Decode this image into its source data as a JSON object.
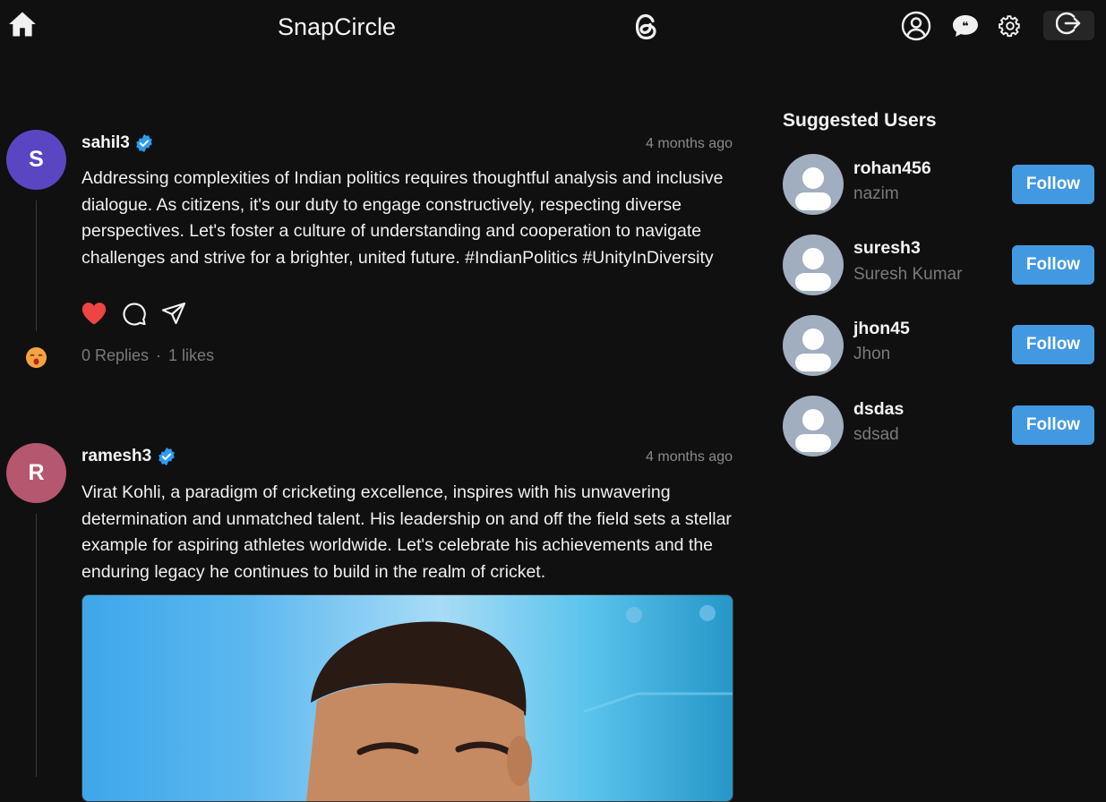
{
  "header": {
    "title": "SnapCircle",
    "icons": [
      "home-icon",
      "threads-logo-icon",
      "profile-icon",
      "chat-icon",
      "gear-icon",
      "logout-icon"
    ]
  },
  "posts": [
    {
      "avatar_letter": "S",
      "avatar_color": "#5a46c2",
      "username": "sahil3",
      "time": "4 months ago",
      "text": "Addressing complexities of Indian politics requires thoughtful analysis and inclusive dialogue. As citizens, it's our duty to engage constructively, respecting diverse perspectives. Let's foster a culture of understanding and cooperation to navigate challenges and strive for a brighter, united future. #IndianPolitics #UnityInDiversity",
      "replies": "0 Replies",
      "separator": "·",
      "likes": "1 likes",
      "liked": true
    },
    {
      "avatar_letter": "R",
      "avatar_color": "#b5576e",
      "username": "ramesh3",
      "time": "4 months ago",
      "text": "Virat Kohli, a paradigm of cricketing excellence, inspires with his unwavering determination and unmatched talent. His leadership on and off the field sets a stellar example for aspiring athletes worldwide. Let's celebrate his achievements and the enduring legacy he continues to build in the realm of cricket."
    }
  ],
  "suggested": {
    "title": "Suggested Users",
    "users": [
      {
        "username": "rohan456",
        "name": "nazim",
        "button": "Follow"
      },
      {
        "username": "suresh3",
        "name": "Suresh Kumar",
        "button": "Follow"
      },
      {
        "username": "jhon45",
        "name": "Jhon",
        "button": "Follow"
      },
      {
        "username": "dsdas",
        "name": "sdsad",
        "button": "Follow"
      }
    ]
  },
  "colors": {
    "background": "#101010",
    "accent": "#4299e1",
    "verified": "#2f9bf0",
    "like": "#ef4444"
  }
}
